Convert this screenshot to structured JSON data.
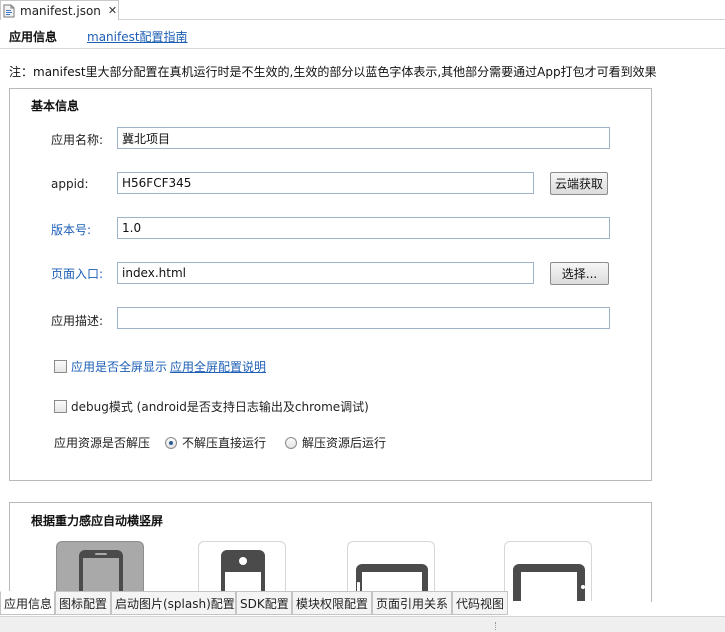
{
  "editor_tab": {
    "title": "manifest.json",
    "close": "✕"
  },
  "nav": {
    "app_info": "应用信息",
    "guide_link": "manifest配置指南"
  },
  "notice": "注：manifest里大部分配置在真机运行时是不生效的,生效的部分以蓝色字体表示,其他部分需要通过App打包才可看到效果",
  "basic": {
    "title": "基本信息",
    "app_name": {
      "label": "应用名称:",
      "value": "冀北项目"
    },
    "appid": {
      "label": "appid:",
      "value": "H56FCF345",
      "button": "云端获取"
    },
    "version": {
      "label": "版本号:",
      "value": "1.0"
    },
    "entry": {
      "label": "页面入口:",
      "value": "index.html",
      "button": "选择..."
    },
    "description": {
      "label": "应用描述:",
      "value": ""
    },
    "fullscreen": {
      "label": "应用是否全屏显示",
      "link": "应用全屏配置说明",
      "checked": false
    },
    "debug": {
      "label": "debug模式 (android是否支持日志输出及chrome调试)",
      "checked": false
    },
    "unpack": {
      "label": "应用资源是否解压",
      "options": [
        {
          "label": "不解压直接运行",
          "selected": true
        },
        {
          "label": "解压资源后运行",
          "selected": false
        }
      ]
    }
  },
  "gravity": {
    "title": "根据重力感应自动横竖屏",
    "orientations": [
      {
        "icon": "portrait-phone-icon",
        "selected": true
      },
      {
        "icon": "portrait-reverse-phone-icon",
        "selected": false
      },
      {
        "icon": "landscape-left-phone-icon",
        "selected": false
      },
      {
        "icon": "landscape-right-phone-icon",
        "selected": false
      }
    ]
  },
  "bottom_tabs": [
    {
      "label": "应用信息",
      "active": true
    },
    {
      "label": "图标配置",
      "active": false
    },
    {
      "label": "启动图片(splash)配置",
      "active": false
    },
    {
      "label": "SDK配置",
      "active": false
    },
    {
      "label": "模块权限配置",
      "active": false
    },
    {
      "label": "页面引用关系",
      "active": false
    },
    {
      "label": "代码视图",
      "active": false
    }
  ],
  "colors": {
    "link_blue": "#1d5fb5",
    "selected_tile": "#a9a9a9",
    "group_border": "#b9b9b9"
  }
}
